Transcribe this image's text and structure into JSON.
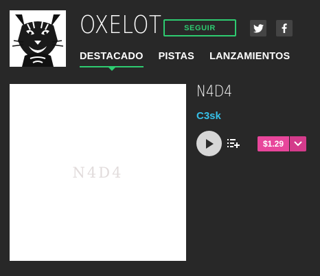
{
  "artist": {
    "name": "OXELOT",
    "follow_label": "SEGUIR"
  },
  "social": {
    "twitter_icon": "twitter-icon",
    "facebook_icon": "facebook-icon"
  },
  "tabs": [
    {
      "label": "DESTACADO",
      "active": true
    },
    {
      "label": "PISTAS",
      "active": false
    },
    {
      "label": "LANZAMIENTOS",
      "active": false
    }
  ],
  "release": {
    "cover_text": "N4D4",
    "title": "N4D4",
    "artist": "C3sk",
    "price": "$1.29"
  },
  "colors": {
    "background": "#282828",
    "accent_green": "#2ecc71",
    "artist_link": "#36c0e8",
    "price_pink": "#e8469b"
  }
}
